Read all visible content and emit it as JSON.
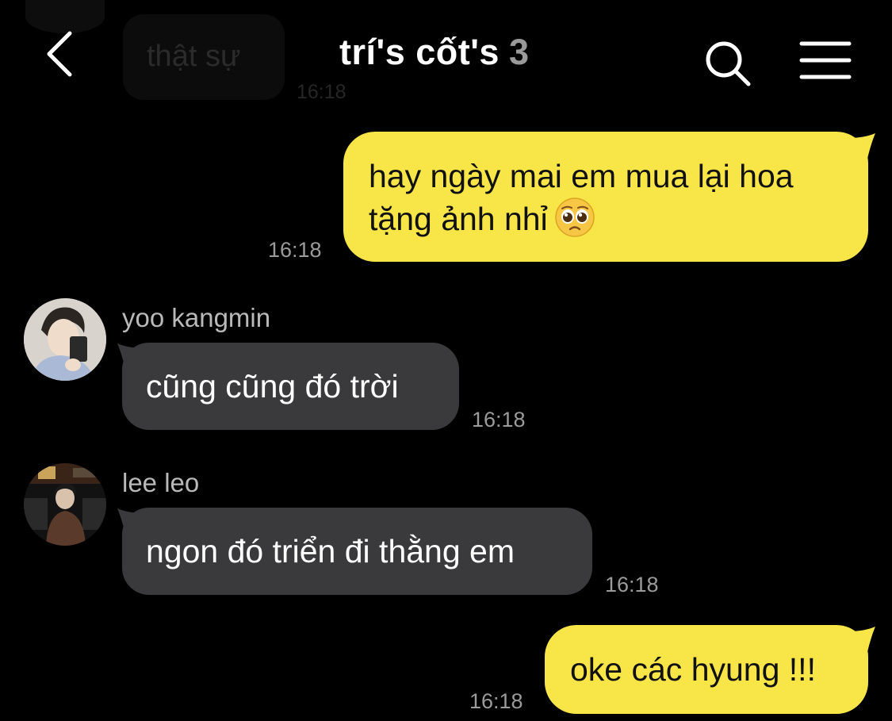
{
  "header": {
    "title": "trí's cốt's",
    "member_count": "3"
  },
  "ghost_message": {
    "text": "thật sự",
    "time": "16:18"
  },
  "messages": [
    {
      "direction": "outgoing",
      "lines": [
        "hay ngày mai em mua lại hoa",
        "tặng ảnh nhỉ"
      ],
      "emoji": "pleading-face",
      "time": "16:18"
    },
    {
      "direction": "incoming",
      "sender": "yoo kangmin",
      "text": "cũng cũng đó trời",
      "time": "16:18"
    },
    {
      "direction": "incoming",
      "sender": "lee leo",
      "text": "ngon đó triển đi thằng em",
      "time": "16:18"
    },
    {
      "direction": "outgoing",
      "text": "oke các hyung !!!",
      "time": "16:18"
    }
  ],
  "colors": {
    "background": "#000000",
    "outgoing_bubble": "#f8e649",
    "incoming_bubble": "#3a3a3c",
    "timestamp": "#9b9b9b",
    "sender_name": "#b9b9b9"
  },
  "icons": {
    "back": "chevron-left-icon",
    "search": "search-icon",
    "menu": "hamburger-menu-icon"
  }
}
